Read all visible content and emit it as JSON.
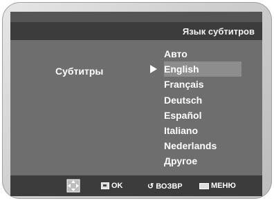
{
  "header": {
    "title": "Язык субтитров"
  },
  "main": {
    "label": "Субтитры",
    "options": [
      "Авто",
      "English",
      "Français",
      "Deutsch",
      "Español",
      "Italiano",
      "Nederlands",
      "Другое"
    ],
    "selected_index": 1
  },
  "footer": {
    "ok_label": "OK",
    "back_label": "ВОЗВР",
    "menu_label": "МЕНЮ"
  },
  "icons": {
    "nav": "dpad-icon",
    "ok": "ok-icon",
    "back": "return-icon",
    "menu": "menu-icon"
  }
}
